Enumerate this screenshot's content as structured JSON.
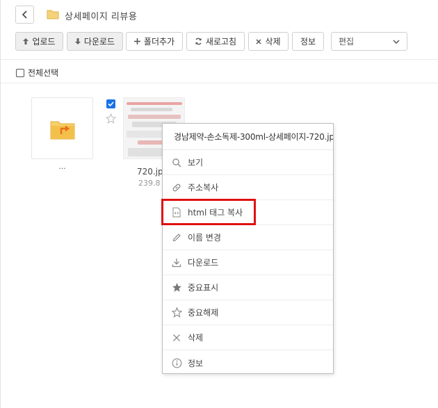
{
  "header": {
    "folder_title": "상세페이지 리뷰용"
  },
  "toolbar": {
    "upload_label": "업로드",
    "download_label": "다운로드",
    "add_folder_label": "폴더추가",
    "refresh_label": "새로고침",
    "delete_label": "삭제",
    "info_label": "정보",
    "edit_select_value": "편집"
  },
  "select_all_label": "전체선택",
  "parent_folder_label": "...",
  "file": {
    "name": "720.jp",
    "size": "239.8 l",
    "checked": true
  },
  "context_menu": {
    "title": "경남제약-손소독제-300ml-상세페이지-720.jpg",
    "items": [
      {
        "label": "보기",
        "icon": "search-icon"
      },
      {
        "label": "주소복사",
        "icon": "link-icon"
      },
      {
        "label": "html 태그 복사",
        "icon": "code-file-icon"
      },
      {
        "label": "이름 변경",
        "icon": "pencil-icon"
      },
      {
        "label": "다운로드",
        "icon": "download-icon"
      },
      {
        "label": "중요표시",
        "icon": "star-filled-icon"
      },
      {
        "label": "중요해제",
        "icon": "star-outline-icon"
      },
      {
        "label": "삭제",
        "icon": "close-icon"
      },
      {
        "label": "정보",
        "icon": "info-icon"
      }
    ]
  },
  "colors": {
    "highlight": "#e01010",
    "checkbox_accent": "#1a73e8",
    "folder": "#f2c04b"
  }
}
